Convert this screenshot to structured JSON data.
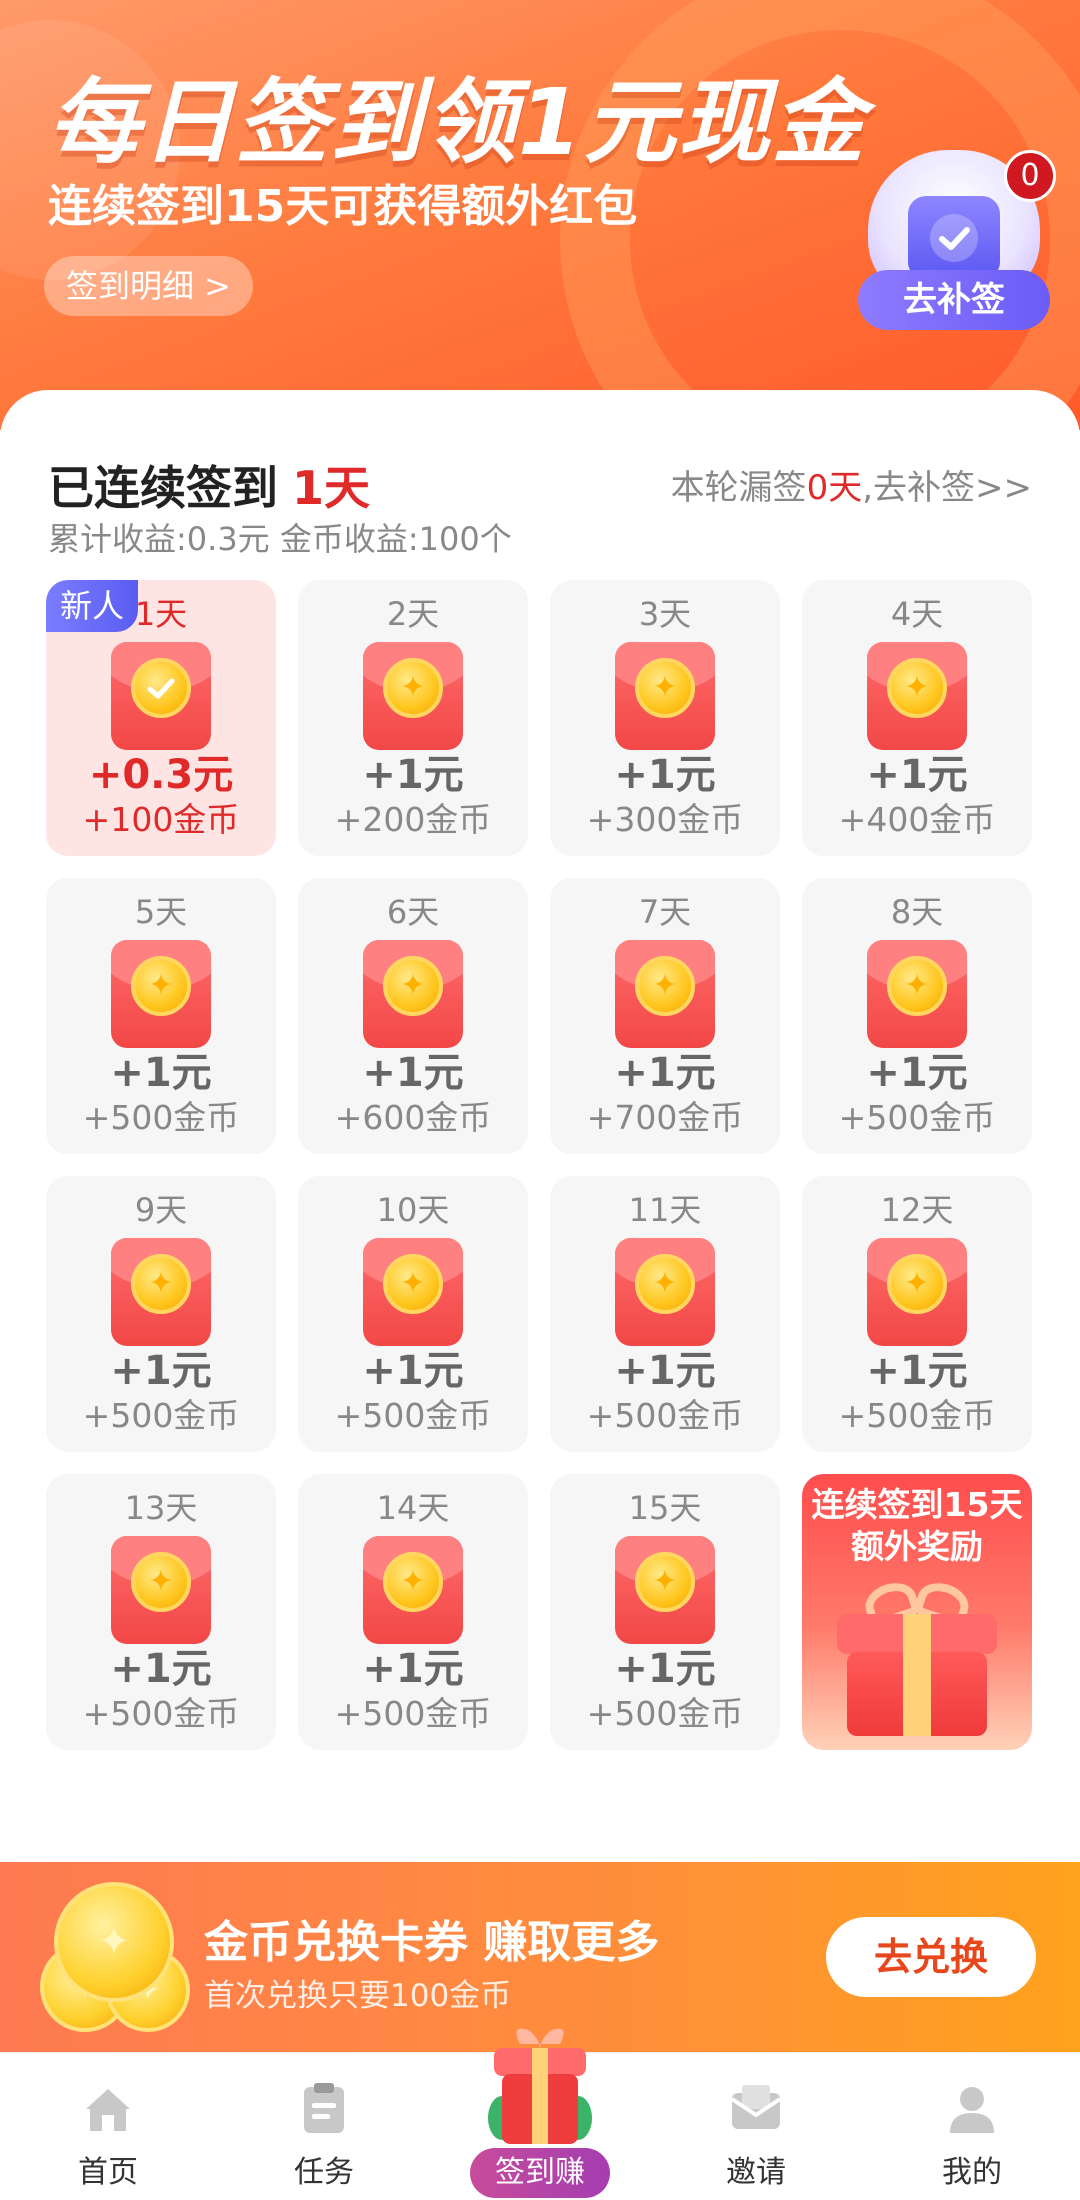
{
  "banner": {
    "title": "每日签到领1元现金",
    "subtitle": "连续签到15天可获得额外红包",
    "detail_button": "签到明细 >",
    "makeup_button": "去补签",
    "makeup_count": "0"
  },
  "panel": {
    "streak_prefix": "已连续签到",
    "streak_days": "1天",
    "missed_prefix": "本轮漏签",
    "missed_days": "0天",
    "missed_suffix": ",去补签>>",
    "earnings": "累计收益:0.3元 金币收益:100个",
    "newbie_tag": "新人",
    "days": [
      {
        "day": "1天",
        "yuan": "+0.3元",
        "coins": "+100金币",
        "checked": true
      },
      {
        "day": "2天",
        "yuan": "+1元",
        "coins": "+200金币"
      },
      {
        "day": "3天",
        "yuan": "+1元",
        "coins": "+300金币"
      },
      {
        "day": "4天",
        "yuan": "+1元",
        "coins": "+400金币"
      },
      {
        "day": "5天",
        "yuan": "+1元",
        "coins": "+500金币"
      },
      {
        "day": "6天",
        "yuan": "+1元",
        "coins": "+600金币"
      },
      {
        "day": "7天",
        "yuan": "+1元",
        "coins": "+700金币"
      },
      {
        "day": "8天",
        "yuan": "+1元",
        "coins": "+500金币"
      },
      {
        "day": "9天",
        "yuan": "+1元",
        "coins": "+500金币"
      },
      {
        "day": "10天",
        "yuan": "+1元",
        "coins": "+500金币"
      },
      {
        "day": "11天",
        "yuan": "+1元",
        "coins": "+500金币"
      },
      {
        "day": "12天",
        "yuan": "+1元",
        "coins": "+500金币"
      },
      {
        "day": "13天",
        "yuan": "+1元",
        "coins": "+500金币"
      },
      {
        "day": "14天",
        "yuan": "+1元",
        "coins": "+500金币"
      },
      {
        "day": "15天",
        "yuan": "+1元",
        "coins": "+500金币"
      }
    ],
    "bonus": {
      "line1": "连续签到15天",
      "line2": "额外奖励"
    }
  },
  "exchange": {
    "title": "金币兑换卡券 赚取更多",
    "subtitle": "首次兑换只要100金币",
    "button": "去兑换"
  },
  "nav": {
    "items": [
      {
        "label": "首页",
        "icon": "home-icon"
      },
      {
        "label": "任务",
        "icon": "clipboard-icon"
      },
      {
        "label": "签到赚",
        "icon": "gift-icon",
        "active": true
      },
      {
        "label": "邀请",
        "icon": "envelope-icon"
      },
      {
        "label": "我的",
        "icon": "user-icon"
      }
    ]
  },
  "colors": {
    "accent_red": "#e02a2a",
    "banner_orange": "#ff7a3d",
    "makeup_purple": "#6a5cf6",
    "exchange_orange": "#ff8f3a"
  }
}
